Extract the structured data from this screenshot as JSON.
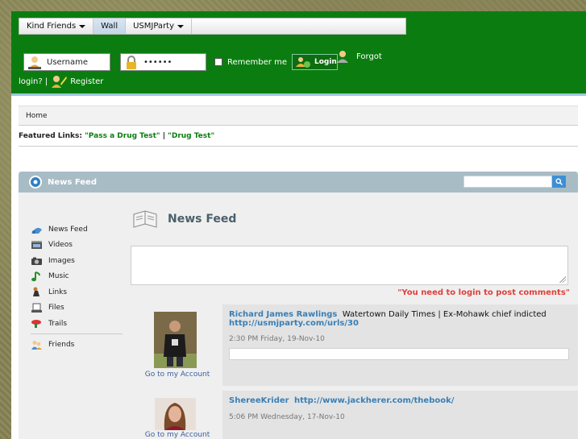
{
  "nav": {
    "items": [
      {
        "label": "Kind Friends",
        "has_caret": true
      },
      {
        "label": "Wall",
        "has_caret": false,
        "active": true
      },
      {
        "label": "USMJParty",
        "has_caret": true
      }
    ]
  },
  "login": {
    "username_placeholder": "Username",
    "password_value": "••••••",
    "remember_label": "Remember me",
    "login_label": "Login",
    "forgot_label": "Forgot",
    "forgot_cont": "login? |",
    "register_label": "Register"
  },
  "breadcrumb": {
    "home": "Home"
  },
  "featured": {
    "label": "Featured Links:",
    "link1": "\"Pass a Drug Test\"",
    "sep": "|",
    "link2": "\"Drug Test\""
  },
  "panel": {
    "title": "News Feed"
  },
  "sidebar": {
    "items": [
      {
        "label": "News Feed",
        "icon": "news-feed-icon"
      },
      {
        "label": "Videos",
        "icon": "videos-icon"
      },
      {
        "label": "Images",
        "icon": "camera-icon"
      },
      {
        "label": "Music",
        "icon": "music-note-icon"
      },
      {
        "label": "Links",
        "icon": "links-icon"
      },
      {
        "label": "Files",
        "icon": "files-icon"
      },
      {
        "label": "Trails",
        "icon": "trails-icon"
      },
      {
        "label": "Friends",
        "icon": "friends-icon"
      }
    ]
  },
  "main": {
    "title": "News Feed",
    "login_note": "\"You need to login to post comments\""
  },
  "feed": [
    {
      "author": "Richard James Rawlings",
      "text": "Watertown Daily Times | Ex-Mohawk chief indicted",
      "link": "http://usmjparty.com/urls/30",
      "timestamp": "2:30 PM Friday, 19-Nov-10",
      "goto": "Go to my Account"
    },
    {
      "author": "ShereeKrider",
      "text": "",
      "link": "http://www.jackherer.com/thebook/",
      "timestamp": "5:06 PM Wednesday, 17-Nov-10",
      "goto": "Go to my Account"
    }
  ],
  "colors": {
    "header_green": "#0b7d10",
    "link_blue": "#3a7fb5",
    "warning_red": "#e0403a",
    "panel_head": "#a8bcc5"
  }
}
